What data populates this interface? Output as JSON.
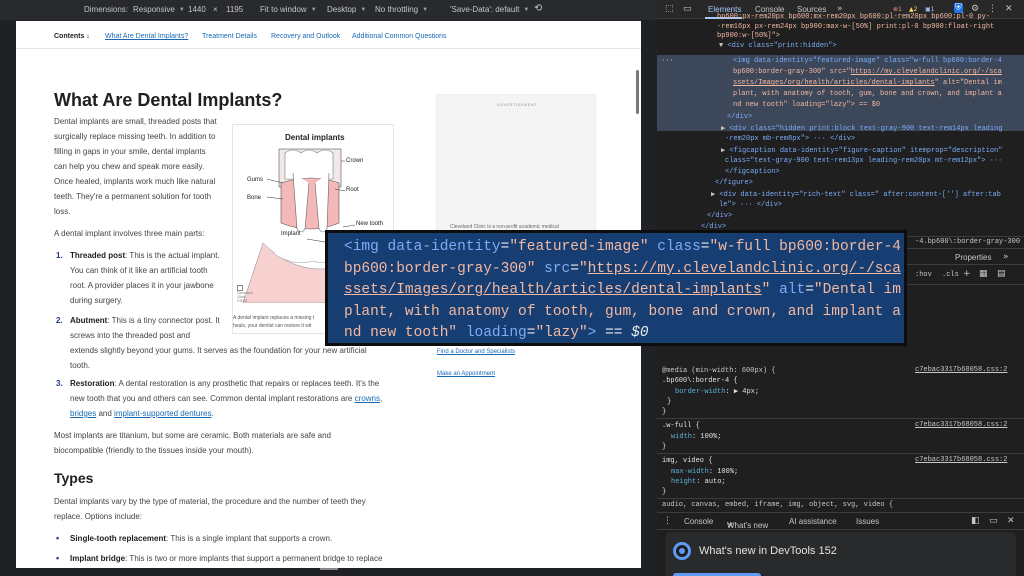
{
  "device_toolbar": {
    "dimensions_label": "Dimensions:",
    "dimensions_value": "Responsive",
    "width": "1440",
    "times": "×",
    "height": "1195",
    "zoom": "Fit to window",
    "device_type": "Desktop",
    "throttling": "No throttling",
    "save_data": "'Save-Data': default"
  },
  "page": {
    "nav": {
      "contents": "Contents",
      "items": [
        "What Are Dental Implants?",
        "Treatment Details",
        "Recovery and Outlook",
        "Additional Common Questions"
      ]
    },
    "title": "What Are Dental Implants?",
    "intro_lines": [
      "Dental implants are small, threaded posts that",
      "surgically replace missing teeth. In addition to",
      "filling in gaps in your smile, dental implants",
      "can help you chew and speak more easily.",
      "Once healed, implants work much like natural",
      "teeth. They're a permanent solution for tooth",
      "loss."
    ],
    "parts_intro": "A dental implant involves three main parts:",
    "parts": [
      {
        "num": "1.",
        "title": "Threaded post",
        "lines": [
          ": This is the actual implant.",
          "You can think of it like an artificial tooth",
          "root. A provider places it in your jawbone",
          "during surgery."
        ]
      },
      {
        "num": "2.",
        "title": "Abutment",
        "lines": [
          ": This is a tiny connector post. It",
          "screws into the threaded post and",
          "extends slightly beyond your gums. It serves as the foundation for your new artificial",
          "tooth."
        ]
      },
      {
        "num": "3.",
        "title": "Restoration",
        "line1": ": A dental restoration is any prosthetic that repairs or replaces teeth. It's the",
        "line2a": "new tooth that you and others can see. Common dental implant restorations are ",
        "link_crowns": "crowns",
        "comma": ",",
        "link_bridges": "bridges",
        "and": " and ",
        "link_supported": "implant-supported dentures",
        "period": "."
      }
    ],
    "materials_lines": [
      "Most implants are titanium, but some are ceramic. Both materials are safe and",
      "biocompatible (friendly to the tissues inside your mouth)."
    ],
    "types_heading": "Types",
    "types_intro_lines": [
      "Dental implants vary by the type of material, the procedure and the number of teeth they",
      "replace. Options include:"
    ],
    "types": [
      {
        "title": "Single-tooth replacement",
        "text": ": This is a single implant that supports a crown."
      },
      {
        "title": "Implant bridge",
        "text": ": This is two or more implants that support a permanent bridge to replace"
      }
    ],
    "figure": {
      "title": "Dental implants",
      "labels": {
        "crown": "Crown",
        "root": "Root",
        "gums": "Gums",
        "bone": "Bone",
        "new_tooth": "New tooth",
        "implant": "Implant"
      },
      "caption_lines": [
        "A dental implant replaces a missing t",
        "heals, your dentist can restore it wit"
      ],
      "logo_text": [
        "Cleveland",
        "Clinic",
        "©2023"
      ]
    },
    "sidebar": {
      "ad_label": "ADVERTISEMENT",
      "note": "Cleveland Clinic is a non-profit academic medical",
      "links": [
        "Find a Doctor and Specialists",
        "Make an Appointment"
      ]
    }
  },
  "tooltip": {
    "line1": {
      "open": "<img ",
      "a1": "data-identity",
      "eq1": "=",
      "v1": "\"featured-image\"",
      "a2": " class",
      "eq2": "=",
      "v2": "\"w-full bp600:border-4"
    },
    "line2": {
      "v2b": "bp600:border-gray-300\"",
      "a3": " src",
      "eq3": "=",
      "q": "\"",
      "link": "https://my.clevelandclinic.org/-/sca"
    },
    "line3": {
      "link": "ssets/Images/org/health/articles/dental-implants",
      "v3": "\"",
      "a4": " alt",
      "eq4": "=",
      "v4": "\"Dental im"
    },
    "line4": {
      "v4b": "plant, with anatomy of tooth, gum, bone and crown, and implant a"
    },
    "line5": {
      "v4c": "nd new tooth\"",
      "a5": " loading",
      "eq5": "=",
      "v5": "\"lazy\"",
      "close": ">",
      "dollar": " == $0"
    }
  },
  "devtools": {
    "tabs": [
      "Elements",
      "Console",
      "Sources"
    ],
    "badges": {
      "errors": "1",
      "warnings": "2",
      "info": "1"
    },
    "elements": {
      "line0": "bp600:px-rem20px bp600:mx-rem20px bp600:pl-rem20px bp600:pl-0 py-",
      "line0b": "-rem16px px-rem24px bp900:max-w-[50%] print:pl-0 bp900:float-right",
      "line0c": "bp900:w-[50%]\">",
      "div_print": "<div class=\"print:hidden\">",
      "sel1": "<img data-identity=\"featured-image\" class=\"w-full bp600:border-4",
      "sel2": "bp600:border-gray-300\" src=\"",
      "sel2_link": "https://my.clevelandclinic.org/-/sca",
      "sel3_link": "ssets/Images/org/health/articles/dental-implants",
      "sel3": "\" alt=\"Dental im",
      "sel4": "plant, with anatomy of tooth, gum, bone and crown, and implant a",
      "sel5": "nd new tooth\" loading=\"lazy\"> == $0",
      "div_close": "</div>",
      "div_hidden": "<div class=\"hidden print:block text-gray-900 text-rem14px leading",
      "div_hidden2": "-rem20px mb-rem8px\"> ··· </div>",
      "figcap1": "<figcaption data-identity=\"figure-caption\" itemprop=\"description\"",
      "figcap2": "class=\"text-gray-900 text-rem13px leading-rem20px mt-rem12px\"> ··· ",
      "figcap3": "</figcaption>",
      "figure_close": "</figure>",
      "richtext": "<div data-identity=\"rich-text\" class=\" after:content-[''] after:tab",
      "richtext2": "le\"> ··· </div>",
      "div_close2": "</div>",
      "div_close3": "</div>"
    },
    "breadcrumb": "-4.bp600\\:border-gray-300",
    "subtabs": [
      "Properties"
    ],
    "filter": {
      "hov": ":hov",
      "cls": ".cls"
    },
    "styles": {
      "media": "@media (min-width: 600px) {",
      "rule1_sel": ".bp600\\:border-4 {",
      "rule1_prop": "border-width",
      "rule1_val": ": ▶ 4px;",
      "rule1_close": "}",
      "rule1_close2": "}",
      "rule2_sel": ".w-full {",
      "rule2_prop": "width",
      "rule2_val": ": 100%;",
      "rule2_close": "}",
      "rule3_sel": "img, video {",
      "rule3_prop1": "max-width",
      "rule3_val1": ": 100%;",
      "rule3_prop2": "height",
      "rule3_val2": ": auto;",
      "rule3_close": "}",
      "rule4_sel": "audio, canvas, embed, iframe, img, object, svg, video {",
      "source": "c7ebac3317b68058.css:2"
    },
    "drawer": {
      "tabs": [
        "Console",
        "What's new",
        "AI assistance",
        "Issues"
      ],
      "whats_new": "What's new in DevTools 152"
    }
  }
}
